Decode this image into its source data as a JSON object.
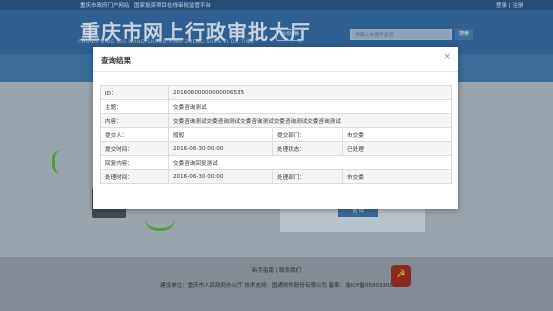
{
  "topbar": {
    "link1": "重庆市政府门户网站",
    "link2": "国家投资项目在线审批监管平台",
    "right": "登录 | 注册"
  },
  "header": {
    "logo_text": "重庆市网上行政审批大厅",
    "logo_pinyin": "CHONG QING SHI WANG SHANG XING ZHENG SHEN PI DA TING",
    "button_label": "站点切换",
    "search_placeholder": "请输入关键字查询",
    "search_button": "搜索"
  },
  "background": {
    "panel_button": "咨 询"
  },
  "modal": {
    "title": "查询结果",
    "close": "×",
    "rows": {
      "id_label": "ID：",
      "id_value": "20160600000000006535",
      "subject_label": "主题：",
      "subject_value": "交委咨询测试",
      "content_label": "内容：",
      "content_value": "交委咨询测试交委咨询测试交委咨询测试交委咨询测试交委咨询测试",
      "submitter_label": "提交人：",
      "submitter_value": "般般",
      "submit_dept_label": "提交部门：",
      "submit_dept_value": "市交委",
      "submit_time_label": "提交时间：",
      "submit_time_value": "2016-06-30 00:00",
      "status_label": "处理状态：",
      "status_value": "已处理",
      "reply_label": "回复内容：",
      "reply_value": "交委咨询回复测试",
      "handle_time_label": "处理时间：",
      "handle_time_value": "2016-06-30 00:00",
      "handle_dept_label": "处理部门：",
      "handle_dept_value": "市交委"
    }
  },
  "footer": {
    "line1": "新手指南 | 联系我们",
    "line2": "建设单位：重庆市人民政府办公厅    技术支持：国通软件股份有限公司    备案：渝ICP备05003300"
  },
  "colors": {
    "topbar": "#244d77",
    "header": "#2e5f90",
    "modal_bg": "#ffffff",
    "overlay": "#7f8a93"
  }
}
